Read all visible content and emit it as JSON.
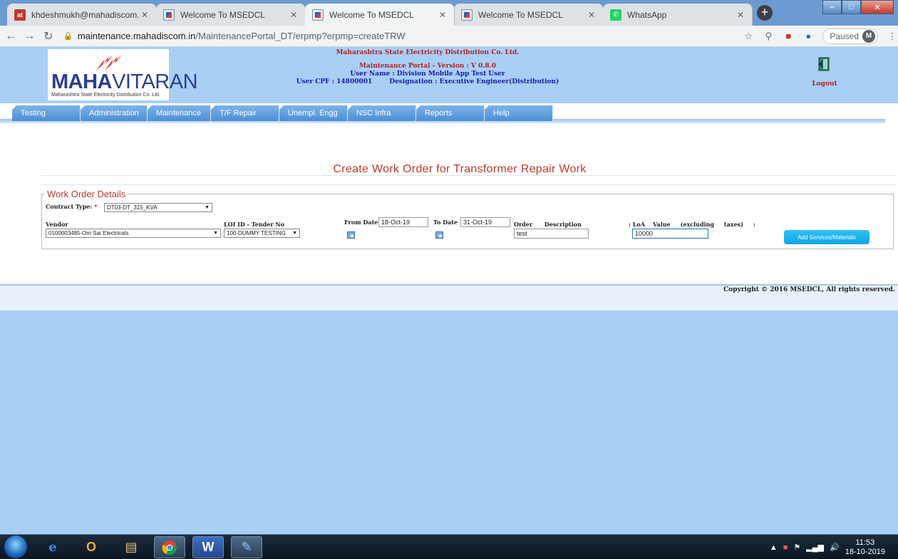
{
  "browser": {
    "tabs": [
      {
        "label": "khdeshmukh@mahadiscom.in...",
        "icon": "mail-icon",
        "active": false
      },
      {
        "label": "Welcome To MSEDCL",
        "icon": "msedcl-favicon-icon",
        "active": false
      },
      {
        "label": "Welcome To MSEDCL",
        "icon": "msedcl-favicon-icon",
        "active": true
      },
      {
        "label": "Welcome To MSEDCL",
        "icon": "msedcl-favicon-icon",
        "active": false
      },
      {
        "label": "WhatsApp",
        "icon": "whatsapp-icon",
        "active": false
      }
    ],
    "url_host": "maintenance.mahadiscom.in",
    "url_path": "/MaintenancePortal_DT/erpmp?erpmp=createTRW",
    "profile_status": "Paused",
    "profile_initial": "M"
  },
  "header": {
    "logo_name_bold": "MAHA",
    "logo_name_rest": "VITARAN",
    "logo_sub": "Maharashtra State Electricity Distribution Co. Ltd.",
    "org": "Maharashtra State Electricity Distribution Co. Ltd.",
    "portal_version": "Maintenance Portal - Version : V 0.8.0",
    "user_name": "User Name : Division Mobile App Test User",
    "user_cpf": "User CPF : 14800001",
    "designation": "Designation : Executive Engineer(Distribution)",
    "logout": "Logout"
  },
  "menu": [
    "Testing",
    "Administration",
    "Maintenance",
    "T/F Repair",
    "Unempl. Engg",
    "NSC Infra",
    "Reports",
    "Help"
  ],
  "form": {
    "page_title": "Create Work Order for Transformer Repair Work",
    "legend": "Work Order Details",
    "contract_type_label": "Contract Type:",
    "required_mark": "*",
    "contract_type_value": "DT03-DT_315_KVA",
    "vendor_label": "Vendor",
    "vendor_value": "0100003485-Om Sai Electricals",
    "loi_label": "LOI ID - Tender No",
    "loi_value": "100-DUMMY TESTING",
    "from_date_label": "From Date",
    "from_date_value": "18-Oct-19",
    "to_date_label": "To Date",
    "to_date_value": "31-Oct-19",
    "order_description_label": "Order      Description",
    "order_description_value": "test",
    "loa_label": ": LoA    Value     (excluding     taxes)     :",
    "loa_value": "10000",
    "add_button": "Add Services/Materials"
  },
  "footer": {
    "copyright": "Copyright © 2016 MSEDCL, All rights reserved."
  },
  "taskbar": {
    "time": "11:53",
    "date": "18-10-2019"
  },
  "colors": {
    "page_bg": "#a9cff5",
    "menu_blue": "#4a8fd6",
    "title_red": "#c0392b",
    "button_cyan": "#12a6e4"
  }
}
